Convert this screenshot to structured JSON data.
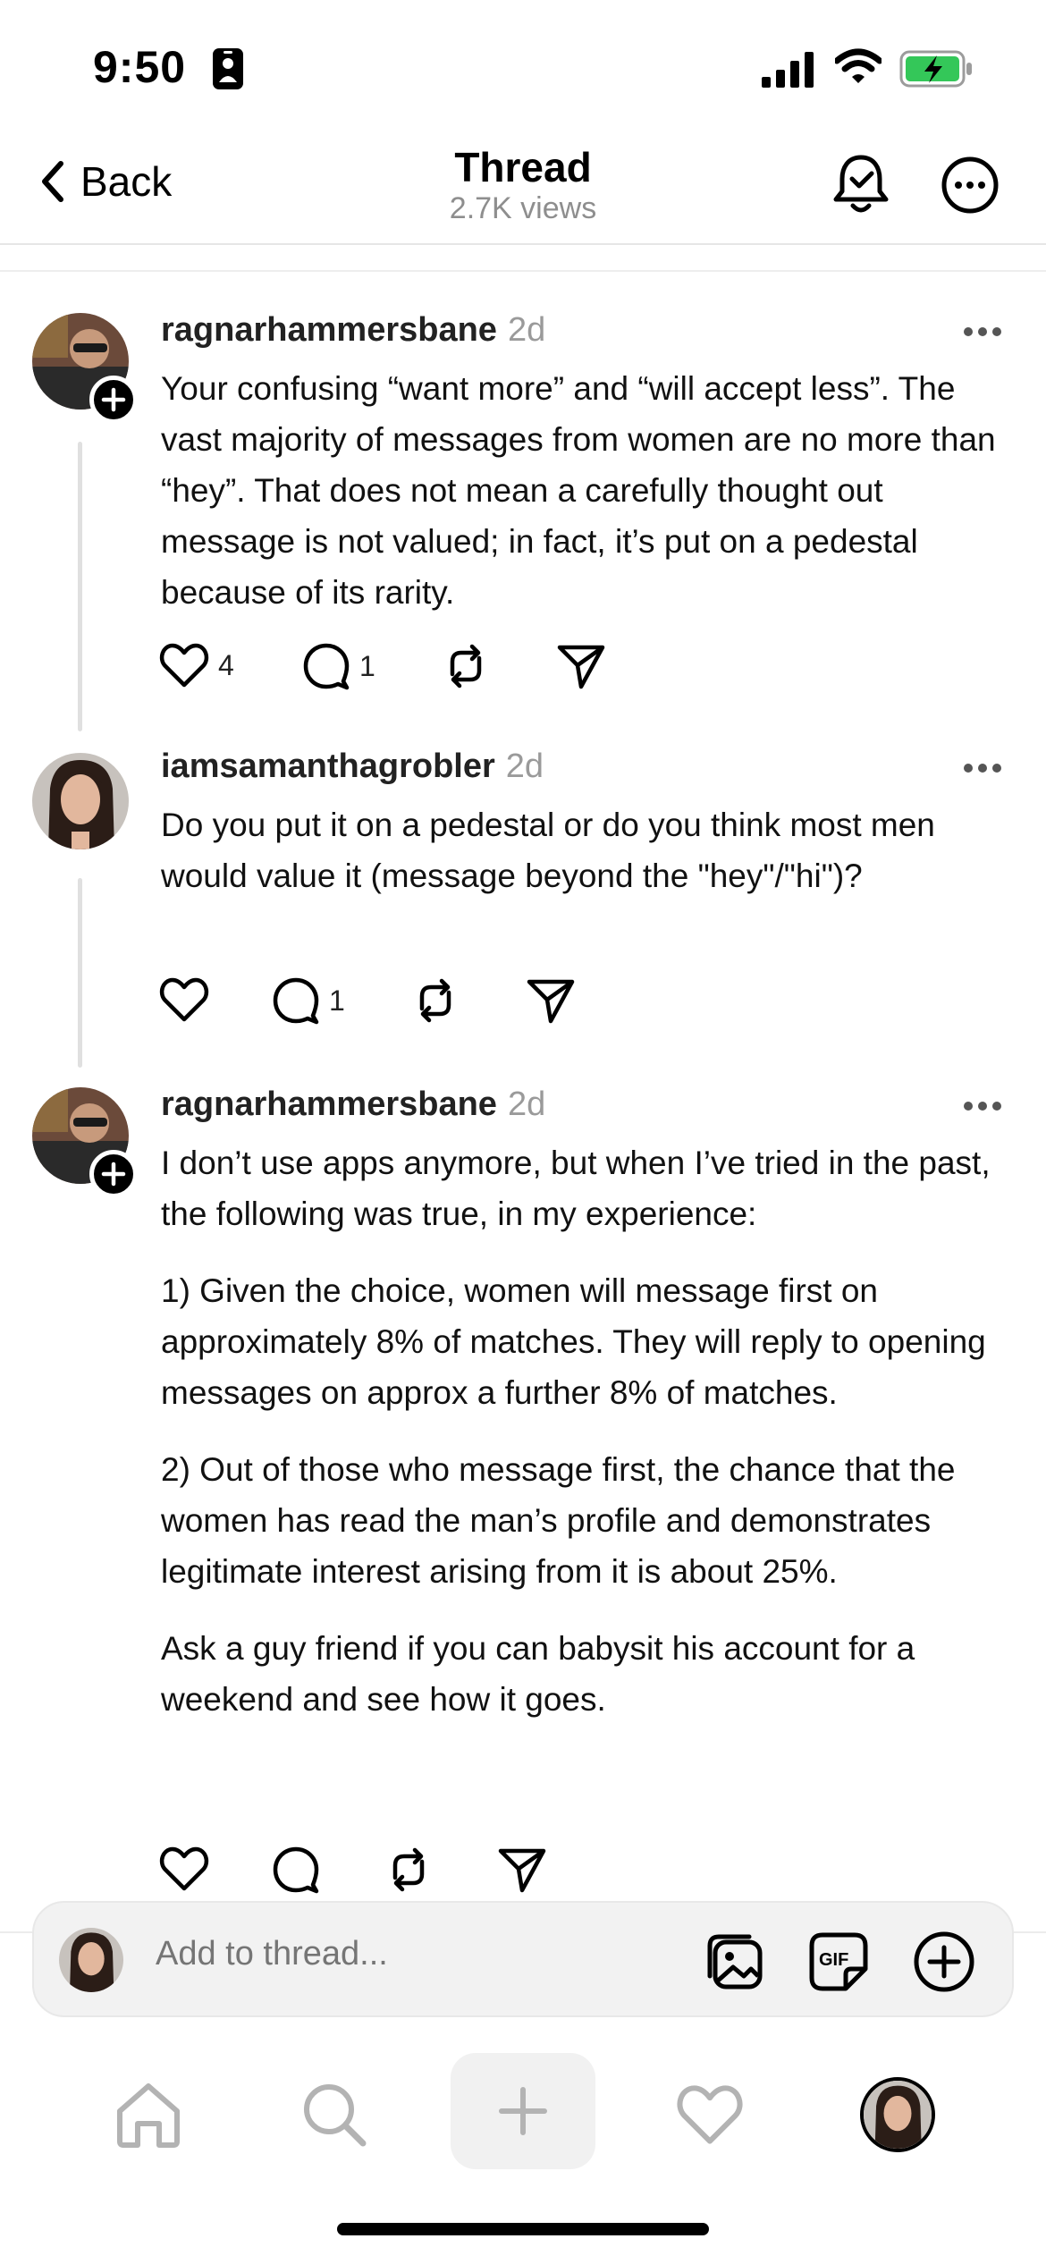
{
  "status_bar": {
    "time": "9:50",
    "icons": [
      "person-badge-icon",
      "cellular-signal-icon",
      "wifi-icon",
      "battery-charging-icon"
    ],
    "battery_color": "#34c759"
  },
  "header": {
    "back_label": "Back",
    "title": "Thread",
    "subtitle": "2.7K views",
    "icons": [
      "back-chevron-icon",
      "notification-bell-icon",
      "more-options-icon"
    ]
  },
  "posts": [
    {
      "username": "ragnarhammersbane",
      "timestamp": "2d",
      "paragraphs": [
        "Your confusing “want more” and “will accept less”. The vast majority of messages from women are no more than “hey”. That does not mean a carefully thought out message is not valued; in fact, it’s put on a pedestal because of its rarity."
      ],
      "like_count": "4",
      "reply_count": "1"
    },
    {
      "username": "iamsamanthagrobler",
      "timestamp": "2d",
      "paragraphs": [
        "Do you put it on a pedestal or do you think most men would value it (message beyond the \"hey\"/\"hi\")?"
      ],
      "like_count": "",
      "reply_count": "1"
    },
    {
      "username": "ragnarhammersbane",
      "timestamp": "2d",
      "paragraphs": [
        "I don’t use apps anymore, but when I’ve tried in the past, the following was true, in my experience:",
        "1) Given the choice, women will message first on approximately 8% of matches.  They will reply to opening messages on approx a further 8% of matches.",
        "2) Out of those who message first, the chance that the women has read the man’s profile and demonstrates legitimate interest arising from it is about 25%.",
        "Ask a guy friend if you can babysit his account for a weekend and see how it goes."
      ],
      "like_count": "",
      "reply_count": ""
    }
  ],
  "composer": {
    "placeholder": "Add to thread...",
    "icons": [
      "photo-library-icon",
      "gif-sticker-icon",
      "add-circle-icon"
    ]
  },
  "tabbar": {
    "icons": [
      "home-icon",
      "search-icon",
      "create-plus-icon",
      "activity-heart-icon",
      "profile-avatar"
    ]
  },
  "colors": {
    "text_primary": "#111111",
    "text_secondary": "#9a9a9a",
    "thread_line": "#e0e0e0"
  }
}
